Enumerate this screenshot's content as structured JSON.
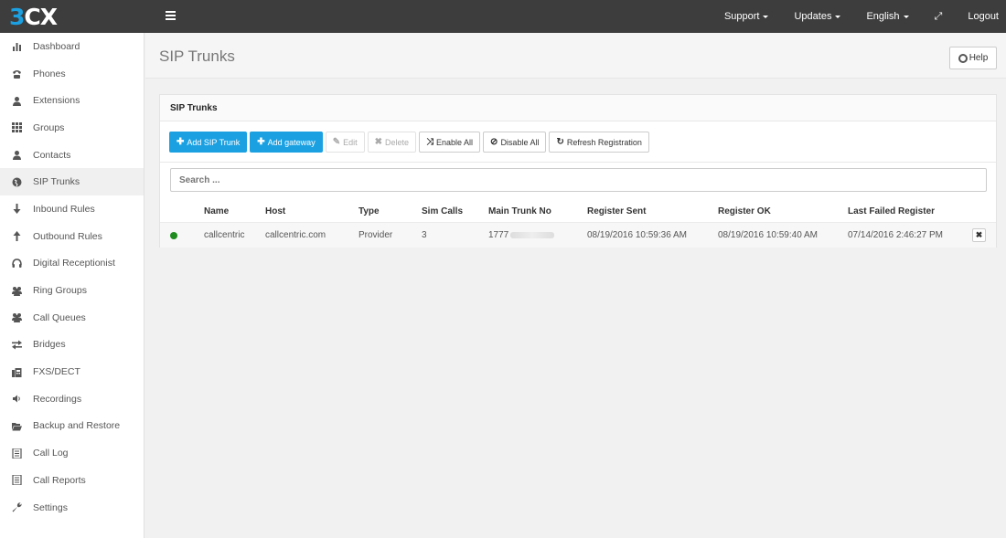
{
  "app": {
    "logo_three": "3",
    "logo_cx": "CX"
  },
  "topnav": {
    "support": "Support",
    "updates": "Updates",
    "language": "English",
    "logout": "Logout"
  },
  "sidebar": {
    "items": [
      {
        "label": "Dashboard",
        "icon": "bar-chart-icon"
      },
      {
        "label": "Phones",
        "icon": "phone-icon"
      },
      {
        "label": "Extensions",
        "icon": "user-icon"
      },
      {
        "label": "Groups",
        "icon": "grid-icon"
      },
      {
        "label": "Contacts",
        "icon": "user-icon"
      },
      {
        "label": "SIP Trunks",
        "icon": "globe-icon",
        "active": true
      },
      {
        "label": "Inbound Rules",
        "icon": "arrow-down-icon"
      },
      {
        "label": "Outbound Rules",
        "icon": "arrow-up-icon"
      },
      {
        "label": "Digital Receptionist",
        "icon": "headset-icon"
      },
      {
        "label": "Ring Groups",
        "icon": "users-icon"
      },
      {
        "label": "Call Queues",
        "icon": "users-icon"
      },
      {
        "label": "Bridges",
        "icon": "transfer-icon"
      },
      {
        "label": "FXS/DECT",
        "icon": "fax-icon"
      },
      {
        "label": "Recordings",
        "icon": "volume-icon"
      },
      {
        "label": "Backup and Restore",
        "icon": "folder-icon"
      },
      {
        "label": "Call Log",
        "icon": "list-icon"
      },
      {
        "label": "Call Reports",
        "icon": "list-icon"
      },
      {
        "label": "Settings",
        "icon": "wrench-icon"
      }
    ]
  },
  "page": {
    "title": "SIP Trunks",
    "help": "Help"
  },
  "panel": {
    "heading": "SIP Trunks",
    "toolbar": {
      "add_sip_trunk": "Add SIP Trunk",
      "add_gateway": "Add gateway",
      "edit": "Edit",
      "delete": "Delete",
      "enable_all": "Enable All",
      "disable_all": "Disable All",
      "refresh_registration": "Refresh Registration"
    },
    "search_placeholder": "Search ...",
    "columns": [
      "Name",
      "Host",
      "Type",
      "Sim Calls",
      "Main Trunk No",
      "Register Sent",
      "Register OK",
      "Last Failed Register"
    ],
    "rows": [
      {
        "status_color": "#1e8c1e",
        "name": "callcentric",
        "host": "callcentric.com",
        "type": "Provider",
        "sim_calls": "3",
        "main_trunk_no": "1777",
        "register_sent": "08/19/2016 10:59:36 AM",
        "register_ok": "08/19/2016 10:59:40 AM",
        "last_failed_register": "07/14/2016 2:46:27 PM"
      }
    ]
  },
  "colors": {
    "accent": "#1ba1e2",
    "topbar": "#3d3d3d",
    "status_online": "#1e8c1e"
  }
}
